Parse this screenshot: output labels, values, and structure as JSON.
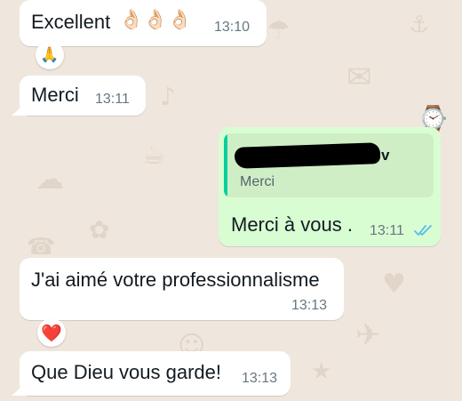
{
  "messages": [
    {
      "text": "Excellent",
      "emojis": "👌🏻👌🏻👌🏻",
      "time": "13:10",
      "reaction": "🙏"
    },
    {
      "text": "Merci",
      "time": "13:11"
    },
    {
      "quote_author_suffix": "v",
      "quote_text": "Merci",
      "text": "Merci à vous .",
      "time": "13:11",
      "status": "read"
    },
    {
      "text": "J'ai aimé votre professionnalisme",
      "time": "13:13",
      "reaction": "❤️"
    },
    {
      "text": "Que Dieu vous garde!",
      "time": "13:13"
    }
  ],
  "colors": {
    "wallpaper": "#efe7de",
    "incoming_bubble": "#ffffff",
    "outgoing_bubble": "#d9fdd3",
    "quote_accent": "#06cf9c",
    "read_ticks": "#53bdeb",
    "time_text": "#667781"
  },
  "icons": {
    "read_receipt": "double-check-icon",
    "reaction_1": "folded-hands-icon",
    "reaction_2": "red-heart-icon"
  }
}
